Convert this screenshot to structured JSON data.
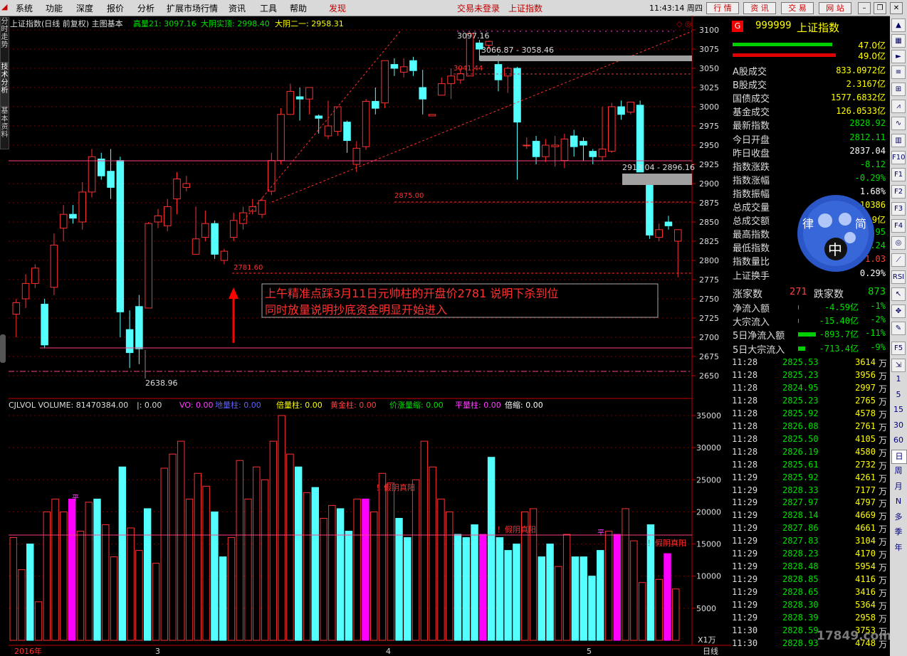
{
  "menu": {
    "items": [
      "系统",
      "功能",
      "深度",
      "报价",
      "分析",
      "扩展市场行情",
      "资讯",
      "工具",
      "帮助"
    ],
    "discover": "发现",
    "login_status": "交易未登录",
    "current_index": "上证指数",
    "clock": "11:43:14 周四",
    "quick_buttons": [
      "行 情",
      "资 讯",
      "交 易",
      "网 站"
    ]
  },
  "left_tabs": [
    "分时走势",
    "技术分析",
    "基本资料"
  ],
  "chart_header": {
    "title": "上证指数(日线 前复权) 主图基本",
    "ind1": "高量21: 3097.16",
    "ind2": "大阴实顶: 2998.40",
    "ind3": "大阴二一: 2958.31"
  },
  "volume_header": {
    "label": "CJLVOL VOLUME: 81470384.00",
    "pipe": "|: 0.00",
    "items": [
      {
        "name": "VO: 0.00",
        "color": "#ff40ff"
      },
      {
        "name": "地量柱: 0.00",
        "color": "#6060ff"
      },
      {
        "name": "倍量柱: 0.00",
        "color": "#ffff00"
      },
      {
        "name": "黄金柱: 0.00",
        "color": "#ff4040"
      },
      {
        "name": "价涨量缩: 0.00",
        "color": "#00e000"
      },
      {
        "name": "平量柱: 0.00",
        "color": "#ff40ff"
      },
      {
        "name": "倍缩: 0.00",
        "color": "#ffffff"
      }
    ]
  },
  "annotation": {
    "line1": "上午精准点踩3月11日元帅柱的开盘价2781  说明下杀到位",
    "line2": "同时放量说明抄底资金明显开始进入"
  },
  "chart_labels": {
    "high": "3097.16",
    "low": "2638.96",
    "gap1": "3066.87 - 3058.46",
    "gap2": "2913.04 - 2896.16",
    "p3041": "3041.44",
    "p2875": "2875.00",
    "p2781": "2781.60",
    "fake1": "！假阴真阳",
    "fake2": "！假阴真阳",
    "fake3": "！假阴真阳",
    "ping": "平",
    "unit": "X1万"
  },
  "x_axis": [
    "2016年",
    "3",
    "4",
    "5"
  ],
  "period_label": "日线",
  "chart_data": {
    "type": "candlestick",
    "price_axis": [
      3100,
      3075,
      3050,
      3025,
      3000,
      2975,
      2950,
      2925,
      2900,
      2875,
      2850,
      2825,
      2800,
      2775,
      2750,
      2725,
      2700,
      2675,
      2650
    ],
    "volume_axis": [
      35000,
      30000,
      25000,
      20000,
      15000,
      10000,
      5000
    ],
    "ylim_price": [
      2638,
      3105
    ],
    "ylim_volume": [
      0,
      36000
    ],
    "candles": [
      [
        2730,
        2745,
        2700,
        2750
      ],
      [
        2750,
        2770,
        2738,
        2782
      ],
      [
        2770,
        2790,
        2764,
        2795
      ],
      [
        2743,
        2690,
        2686,
        2750
      ],
      [
        2765,
        2820,
        2755,
        2835
      ],
      [
        2842,
        2860,
        2825,
        2872
      ],
      [
        2860,
        2855,
        2848,
        2872
      ],
      [
        2850,
        2889,
        2840,
        2902
      ],
      [
        2889,
        2935,
        2882,
        2945
      ],
      [
        2932,
        2910,
        2905,
        2940
      ],
      [
        2916,
        2895,
        2880,
        2945
      ],
      [
        2930,
        2733,
        2700,
        2935
      ],
      [
        2710,
        2680,
        2660,
        2735
      ],
      [
        2740,
        2685,
        2665,
        2755
      ],
      [
        2738,
        2848,
        2738,
        2850
      ],
      [
        2850,
        2858,
        2842,
        2867
      ],
      [
        2845,
        2870,
        2838,
        2880
      ],
      [
        2880,
        2906,
        2860,
        2915
      ],
      [
        2895,
        2900,
        2890,
        2910
      ],
      [
        2808,
        2828,
        2810,
        2870
      ],
      [
        2830,
        2848,
        2825,
        2865
      ],
      [
        2848,
        2808,
        2802,
        2852
      ],
      [
        2800,
        2812,
        2795,
        2815
      ],
      [
        2830,
        2852,
        2825,
        2862
      ],
      [
        2848,
        2862,
        2840,
        2870
      ],
      [
        2864,
        2870,
        2860,
        2880
      ],
      [
        2860,
        2878,
        2855,
        2882
      ],
      [
        2890,
        2930,
        2885,
        2940
      ],
      [
        2930,
        2990,
        2925,
        2998
      ],
      [
        2990,
        3020,
        2990,
        3030
      ],
      [
        3013,
        3010,
        2982,
        3025
      ],
      [
        3010,
        3025,
        2990,
        3025
      ],
      [
        2988,
        2985,
        2965,
        2990
      ],
      [
        2962,
        2975,
        2958,
        3008
      ],
      [
        2968,
        3000,
        2962,
        3000
      ],
      [
        2980,
        2956,
        2940,
        2982
      ],
      [
        2925,
        2946,
        2915,
        2955
      ],
      [
        2948,
        3007,
        2944,
        3010
      ],
      [
        3007,
        2998,
        2990,
        3025
      ],
      [
        3005,
        3060,
        2998,
        3060
      ],
      [
        3055,
        3050,
        3040,
        3063
      ],
      [
        3045,
        3052,
        3038,
        3063
      ],
      [
        3060,
        3047,
        3040,
        3065
      ],
      [
        3025,
        3010,
        2990,
        3048
      ],
      [
        2988,
        2990,
        2988,
        2988
      ],
      [
        3015,
        3030,
        3015,
        3038
      ],
      [
        3030,
        3040,
        3010,
        3050
      ],
      [
        3035,
        3043,
        3030,
        3050
      ],
      [
        3040,
        3095,
        3040,
        3097
      ],
      [
        3083,
        3075,
        3060,
        3087
      ],
      [
        3080,
        3085,
        3075,
        3086
      ],
      [
        3055,
        3035,
        3020,
        3068
      ],
      [
        3040,
        3050,
        3018,
        3052
      ],
      [
        3050,
        2980,
        2905,
        3052
      ],
      [
        2950,
        2950,
        2945,
        2960
      ],
      [
        2955,
        2935,
        2925,
        2962
      ],
      [
        2935,
        2950,
        2928,
        2958
      ],
      [
        2948,
        2950,
        2922,
        2962
      ],
      [
        2930,
        2958,
        2920,
        2965
      ],
      [
        2962,
        2948,
        2935,
        2970
      ],
      [
        2955,
        2950,
        2930,
        2960
      ],
      [
        2942,
        2935,
        2925,
        2945
      ],
      [
        2935,
        2945,
        2930,
        3000
      ],
      [
        2942,
        3000,
        2940,
        3005
      ],
      [
        3000,
        2990,
        2983,
        3008
      ],
      [
        2993,
        3006,
        2990,
        3006
      ],
      [
        3002,
        2915,
        2915,
        3008
      ],
      [
        2900,
        2833,
        2828,
        2902
      ],
      [
        2830,
        2840,
        2825,
        2848
      ],
      [
        2850,
        2845,
        2840,
        2858
      ],
      [
        2825,
        2840,
        2778,
        2840
      ]
    ],
    "volumes": [
      [
        16000,
        0
      ],
      [
        11000,
        0
      ],
      [
        15000,
        1
      ],
      [
        6000,
        0
      ],
      [
        20000,
        0
      ],
      [
        22000,
        0
      ],
      [
        20000,
        0
      ],
      [
        22000,
        2
      ],
      [
        17000,
        0
      ],
      [
        21500,
        0
      ],
      [
        22000,
        1
      ],
      [
        18000,
        0
      ],
      [
        13000,
        0
      ],
      [
        27000,
        1
      ],
      [
        17500,
        0
      ],
      [
        14000,
        0
      ],
      [
        20500,
        1
      ],
      [
        12000,
        0
      ],
      [
        26800,
        0
      ],
      [
        29000,
        0
      ],
      [
        31000,
        0
      ],
      [
        22000,
        0
      ],
      [
        26000,
        0
      ],
      [
        24000,
        0
      ],
      [
        20000,
        1
      ],
      [
        13000,
        1
      ],
      [
        16000,
        0
      ],
      [
        28000,
        0
      ],
      [
        22000,
        0
      ],
      [
        27000,
        0
      ],
      [
        25000,
        0
      ],
      [
        31000,
        0
      ],
      [
        35000,
        0
      ],
      [
        29000,
        0
      ],
      [
        27000,
        1
      ],
      [
        23000,
        0
      ],
      [
        23800,
        1
      ],
      [
        19000,
        0
      ],
      [
        21000,
        0
      ],
      [
        20500,
        1
      ],
      [
        17000,
        1
      ],
      [
        22000,
        0
      ],
      [
        22000,
        3
      ],
      [
        20000,
        0
      ],
      [
        26000,
        0
      ],
      [
        24500,
        0
      ],
      [
        19000,
        1
      ],
      [
        16000,
        1
      ],
      [
        25000,
        0
      ],
      [
        31000,
        0
      ],
      [
        27000,
        0
      ],
      [
        22000,
        0
      ],
      [
        20000,
        0
      ],
      [
        16500,
        1
      ],
      [
        16000,
        1
      ],
      [
        18000,
        1
      ],
      [
        16500,
        3
      ],
      [
        28500,
        1
      ],
      [
        16000,
        1
      ],
      [
        14000,
        1
      ],
      [
        15000,
        1
      ],
      [
        20000,
        0
      ],
      [
        20500,
        0
      ],
      [
        13000,
        1
      ],
      [
        15000,
        1
      ],
      [
        11500,
        0
      ],
      [
        16500,
        0
      ],
      [
        13000,
        1
      ],
      [
        13000,
        1
      ],
      [
        10000,
        1
      ],
      [
        14000,
        1
      ],
      [
        17000,
        0
      ],
      [
        16500,
        3
      ],
      [
        20500,
        0
      ],
      [
        15500,
        0
      ],
      [
        9000,
        0
      ],
      [
        18000,
        1
      ],
      [
        9500,
        0
      ],
      [
        13500,
        3
      ],
      [
        8000,
        0
      ]
    ]
  },
  "quote": {
    "code_badge": "G",
    "code": "999999",
    "name": "上证指数",
    "buy_vol": "47.0亿",
    "sell_vol": "49.0亿",
    "rows": [
      {
        "k": "A股成交",
        "v": "833.0972亿",
        "c": "#ffff00"
      },
      {
        "k": "B股成交",
        "v": "2.3167亿",
        "c": "#ffff00"
      },
      {
        "k": "国债成交",
        "v": "1577.6832亿",
        "c": "#ffff00"
      },
      {
        "k": "基金成交",
        "v": "126.0533亿",
        "c": "#ffff00"
      },
      {
        "k": "最新指数",
        "v": "2828.92",
        "c": "#00e000"
      },
      {
        "k": "今日开盘",
        "v": "2812.11",
        "c": "#00e000"
      },
      {
        "k": "昨日收盘",
        "v": "2837.04",
        "c": "#ffffff"
      },
      {
        "k": "指数涨跌",
        "v": "-8.12",
        "c": "#00e000"
      },
      {
        "k": "指数涨幅",
        "v": "-0.29%",
        "c": "#00e000"
      },
      {
        "k": "指数振幅",
        "v": "1.68%",
        "c": "#ffffff"
      },
      {
        "k": "总成交量",
        "v": "10386",
        "c": "#ffff00"
      },
      {
        "k": "总成交额",
        "v": "9亿",
        "c": "#ffff00"
      },
      {
        "k": "最高指数",
        "v": "2836.95",
        "c": "#00e000"
      },
      {
        "k": "最低指数",
        "v": "2781.24",
        "c": "#00e000"
      },
      {
        "k": "指数量比",
        "v": "1.03",
        "c": "#ff4040"
      },
      {
        "k": "上证换手",
        "v": "0.29%",
        "c": "#ffffff"
      }
    ],
    "up_label": "涨家数",
    "up_count": "271",
    "down_label": "跌家数",
    "down_count": "873",
    "flows": [
      {
        "k": "净流入额",
        "v": "-4.59亿",
        "p": "-1%",
        "bar": 0
      },
      {
        "k": "大宗流入",
        "v": "-15.40亿",
        "p": "-2%",
        "bar": 0
      },
      {
        "k": "5日净流入额",
        "v": "-893.7亿",
        "p": "-11%",
        "bar": 50
      },
      {
        "k": "5日大宗流入",
        "v": "-713.4亿",
        "p": "-9%",
        "bar": 20
      }
    ],
    "ticks": [
      [
        "11:28",
        "2825.53",
        "3614",
        "万"
      ],
      [
        "11:28",
        "2825.23",
        "3956",
        "万"
      ],
      [
        "11:28",
        "2824.95",
        "2997",
        "万"
      ],
      [
        "11:28",
        "2825.23",
        "2765",
        "万"
      ],
      [
        "11:28",
        "2825.92",
        "4578",
        "万"
      ],
      [
        "11:28",
        "2826.08",
        "2761",
        "万"
      ],
      [
        "11:28",
        "2825.50",
        "4105",
        "万"
      ],
      [
        "11:28",
        "2826.19",
        "4580",
        "万"
      ],
      [
        "11:28",
        "2825.61",
        "2732",
        "万"
      ],
      [
        "11:29",
        "2825.92",
        "4261",
        "万"
      ],
      [
        "11:29",
        "2828.33",
        "7177",
        "万"
      ],
      [
        "11:29",
        "2827.97",
        "4797",
        "万"
      ],
      [
        "11:29",
        "2828.14",
        "4669",
        "万"
      ],
      [
        "11:29",
        "2827.86",
        "4661",
        "万"
      ],
      [
        "11:29",
        "2827.83",
        "3104",
        "万"
      ],
      [
        "11:29",
        "2828.23",
        "4170",
        "万"
      ],
      [
        "11:29",
        "2828.48",
        "5954",
        "万"
      ],
      [
        "11:29",
        "2828.85",
        "4116",
        "万"
      ],
      [
        "11:29",
        "2828.65",
        "3416",
        "万"
      ],
      [
        "11:29",
        "2828.30",
        "5364",
        "万"
      ],
      [
        "11:29",
        "2828.39",
        "2958",
        "万"
      ],
      [
        "11:30",
        "2828.59",
        "3753",
        "万"
      ],
      [
        "11:30",
        "2828.93",
        "4748",
        "万"
      ]
    ],
    "watermark_chars": [
      "律",
      "简",
      "中"
    ],
    "watermark_text": "17849.com"
  },
  "right_toolbar": {
    "periods": [
      "1",
      "5",
      "15",
      "30",
      "60",
      "日",
      "周",
      "月",
      "N",
      "多",
      "季",
      "年"
    ]
  },
  "colors": {
    "up": "#ff3030",
    "down": "#54ffff",
    "special": "#ff00ff",
    "grid": "#7a0000",
    "axis": "#c00000",
    "text_green": "#00e000",
    "yellow": "#ffff00"
  }
}
